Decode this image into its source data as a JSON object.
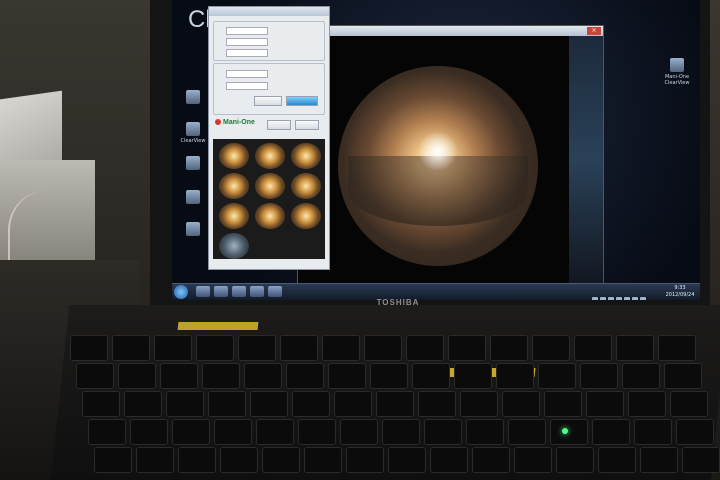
{
  "laptop": {
    "brand": "TOSHIBA"
  },
  "desktop": {
    "app_title_partial": "Cle",
    "icons": [
      {
        "label": "Mani-One ClearView",
        "icon": "shortcut-icon"
      },
      {
        "label": "",
        "icon": "app-icon"
      },
      {
        "label": "ClearView",
        "icon": "app-icon"
      },
      {
        "label": "",
        "icon": "app-icon"
      },
      {
        "label": "",
        "icon": "app-icon"
      },
      {
        "label": "",
        "icon": "app-icon"
      }
    ]
  },
  "panel": {
    "logo": "Mani-One",
    "logo_color": "#1e7a3a",
    "thumbnail_count": 10
  },
  "viewer": {
    "close_glyph": "×"
  },
  "taskbar": {
    "clock_time": "9:33",
    "clock_date": "2012/09/24"
  },
  "colors": {
    "accent_label_sticker": "#bda329",
    "power_led": "#4dff8a"
  }
}
